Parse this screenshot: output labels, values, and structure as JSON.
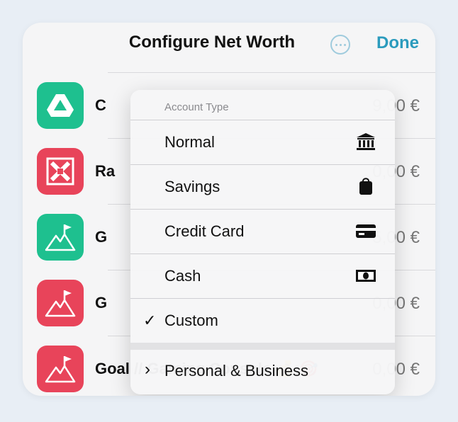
{
  "nav": {
    "title": "Configure Net Worth",
    "more_icon": "ellipsis-circle-icon",
    "done_label": "Done"
  },
  "accounts": [
    {
      "name": "C",
      "amount": "9,00 €",
      "icon": "drive-icon",
      "color": "#1ec08f"
    },
    {
      "name": "Ra",
      "amount": "0,00 €",
      "icon": "bank-logo-icon",
      "color": "#e8445a"
    },
    {
      "name": "G",
      "amount": "5,00 €",
      "icon": "mountain-flag-icon",
      "color": "#1ec08f"
    },
    {
      "name": "G",
      "amount": "0,00 €",
      "icon": "mountain-flag-icon",
      "color": "#e8445a"
    },
    {
      "name": "Goal // Gaming Console 💰 🎯",
      "amount": "0,00 €",
      "icon": "mountain-flag-icon",
      "color": "#e8445a"
    }
  ],
  "menu": {
    "header": "Account Type",
    "items": [
      {
        "label": "Normal",
        "icon": "bank-building-icon"
      },
      {
        "label": "Savings",
        "icon": "bag-icon"
      },
      {
        "label": "Credit Card",
        "icon": "credit-card-icon"
      },
      {
        "label": "Cash",
        "icon": "banknote-icon"
      },
      {
        "label": "Custom",
        "checked": "✓"
      }
    ],
    "submenu": {
      "label": "Personal & Business",
      "chevron": "›"
    }
  },
  "colors": {
    "accent": "#2b9bbd",
    "green": "#1ec08f",
    "red": "#e8445a"
  }
}
